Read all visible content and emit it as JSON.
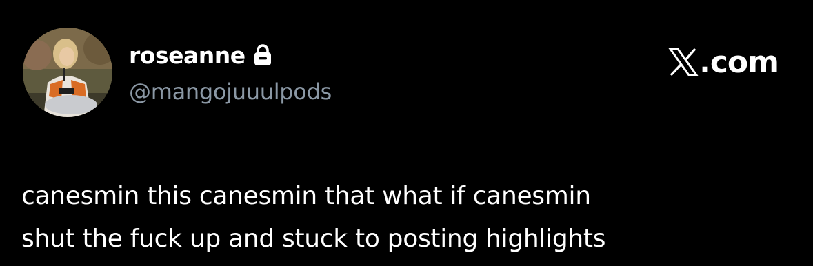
{
  "tweet": {
    "author": {
      "display_name": "roseanne",
      "handle": "@mangojuuulpods",
      "protected_icon": "lock-icon",
      "avatar_icon": "avatar-photo"
    },
    "brand": {
      "logo_icon": "x-logo-icon",
      "suffix": ".com"
    },
    "text_lines": [
      "canesmin this canesmin that what if canesmin",
      "shut the fuck up and stuck to posting highlights"
    ]
  },
  "colors": {
    "background": "#000000",
    "text_primary": "#ffffff",
    "text_secondary": "#8b98a5"
  }
}
